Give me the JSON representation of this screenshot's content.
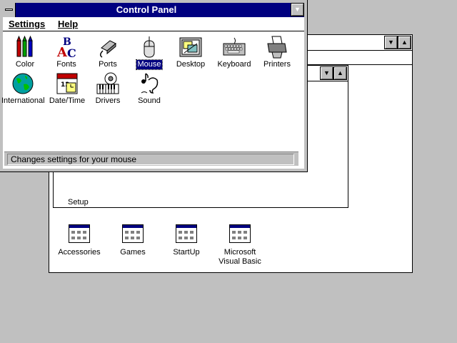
{
  "program_manager": {
    "background_group_label": "Setup",
    "groups": [
      {
        "label": "Accessories"
      },
      {
        "label": "Games"
      },
      {
        "label": "StartUp"
      },
      {
        "label": "Microsoft\nVisual Basic"
      }
    ]
  },
  "control_panel": {
    "title": "Control Panel",
    "menu": {
      "settings": "Settings",
      "help": "Help"
    },
    "items": [
      {
        "label": "Color",
        "icon": "color-icon"
      },
      {
        "label": "Fonts",
        "icon": "fonts-icon"
      },
      {
        "label": "Ports",
        "icon": "ports-icon"
      },
      {
        "label": "Mouse",
        "icon": "mouse-icon",
        "selected": true
      },
      {
        "label": "Desktop",
        "icon": "desktop-icon"
      },
      {
        "label": "Keyboard",
        "icon": "keyboard-icon"
      },
      {
        "label": "Printers",
        "icon": "printers-icon"
      },
      {
        "label": "International",
        "icon": "international-icon"
      },
      {
        "label": "Date/Time",
        "icon": "date-time-icon"
      },
      {
        "label": "Drivers",
        "icon": "drivers-icon"
      },
      {
        "label": "Sound",
        "icon": "sound-icon"
      }
    ],
    "status": "Changes settings for your mouse"
  },
  "colors": {
    "titlebar_active": "#000080",
    "desktop": "#c0c0c0",
    "selection": "#000080"
  }
}
